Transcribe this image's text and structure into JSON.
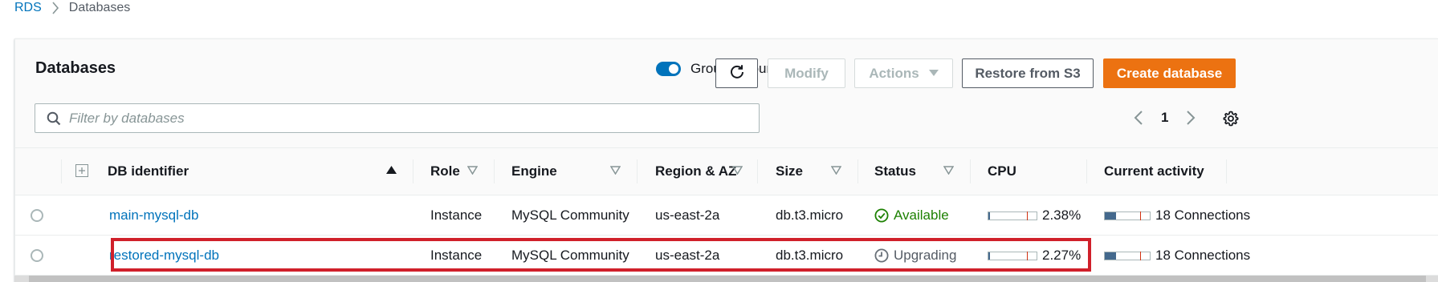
{
  "breadcrumb": {
    "root": "RDS",
    "current": "Databases"
  },
  "panel": {
    "title": "Databases",
    "group_toggle_label": "Group resources",
    "group_toggle_on": true
  },
  "toolbar": {
    "refresh_icon": "refresh-icon",
    "modify_label": "Modify",
    "actions_label": "Actions",
    "restore_label": "Restore from S3",
    "create_label": "Create database"
  },
  "search": {
    "placeholder": "Filter by databases",
    "value": ""
  },
  "pagination": {
    "page": "1"
  },
  "table": {
    "headers": {
      "identifier": "DB identifier",
      "role": "Role",
      "engine": "Engine",
      "region": "Region & AZ",
      "size": "Size",
      "status": "Status",
      "cpu": "CPU",
      "activity": "Current activity"
    },
    "rows": [
      {
        "identifier": "main-mysql-db",
        "role": "Instance",
        "engine": "MySQL Community",
        "region": "us-east-2a",
        "size": "db.t3.micro",
        "status": "Available",
        "cpu": "2.38%",
        "activity": "18 Connections"
      },
      {
        "identifier": "restored-mysql-db",
        "role": "Instance",
        "engine": "MySQL Community",
        "region": "us-east-2a",
        "size": "db.t3.micro",
        "status": "Upgrading",
        "cpu": "2.27%",
        "activity": "18 Connections"
      }
    ]
  },
  "colors": {
    "accent": "#0073bb",
    "primary_button": "#ec7211",
    "status_available": "#1d8102",
    "highlight_box": "#d0202a"
  }
}
